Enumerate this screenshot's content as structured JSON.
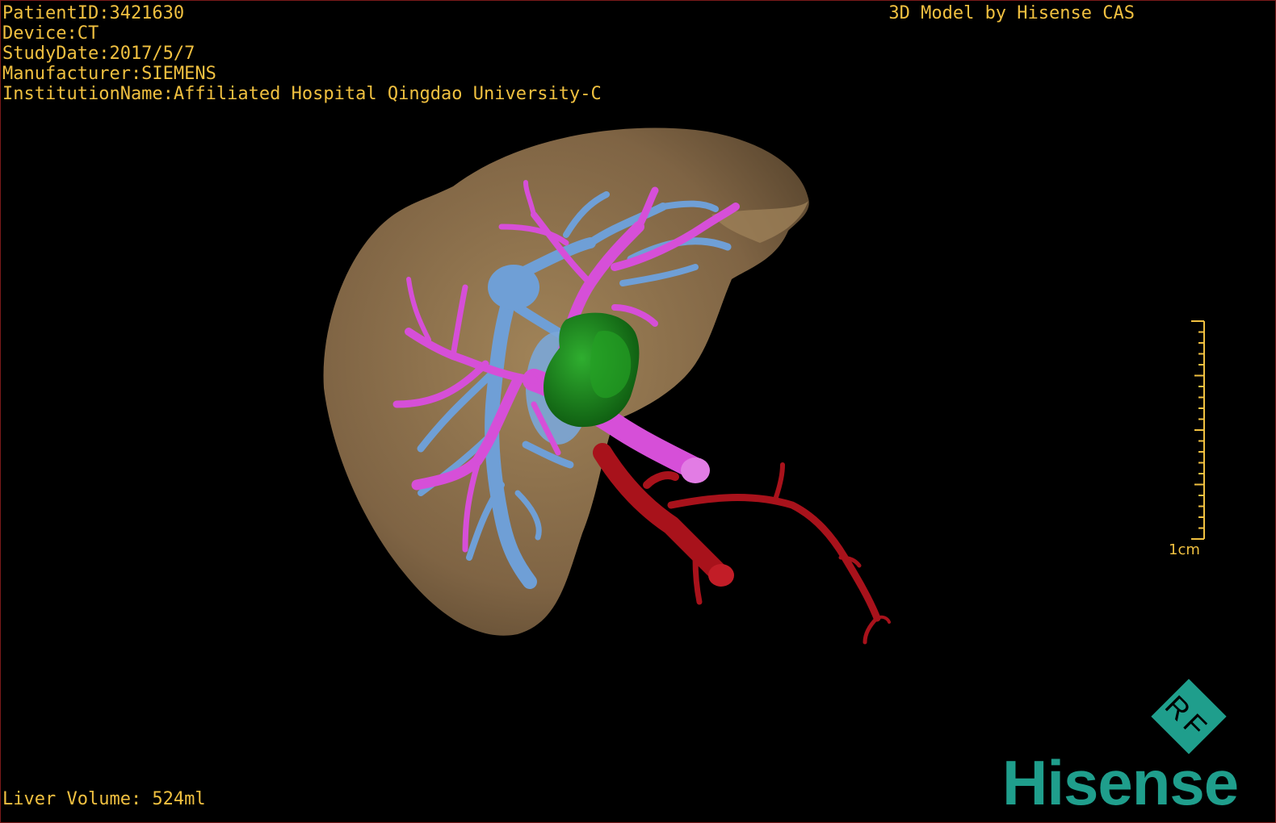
{
  "overlay": {
    "patient_id": "PatientID:3421630",
    "device": "Device:CT",
    "study_date": "StudyDate:2017/5/7",
    "manufacturer": "Manufacturer:SIEMENS",
    "institution": "InstitutionName:Affiliated Hospital Qingdao University-C",
    "credit": "3D Model by Hisense CAS",
    "liver_volume": "Liver Volume: 524ml",
    "scale_label": "1cm"
  },
  "branding": {
    "badge_letters": "RF",
    "logo_text": "Hisense"
  },
  "colors": {
    "overlay_text": "#f0c040",
    "liver": "#8a6c48",
    "portal_vein": "#d64fd8",
    "hepatic_vein": "#6f9fd6",
    "tumor": "#1f8a1f",
    "artery": "#a8121b",
    "brand": "#1f9e8c"
  }
}
